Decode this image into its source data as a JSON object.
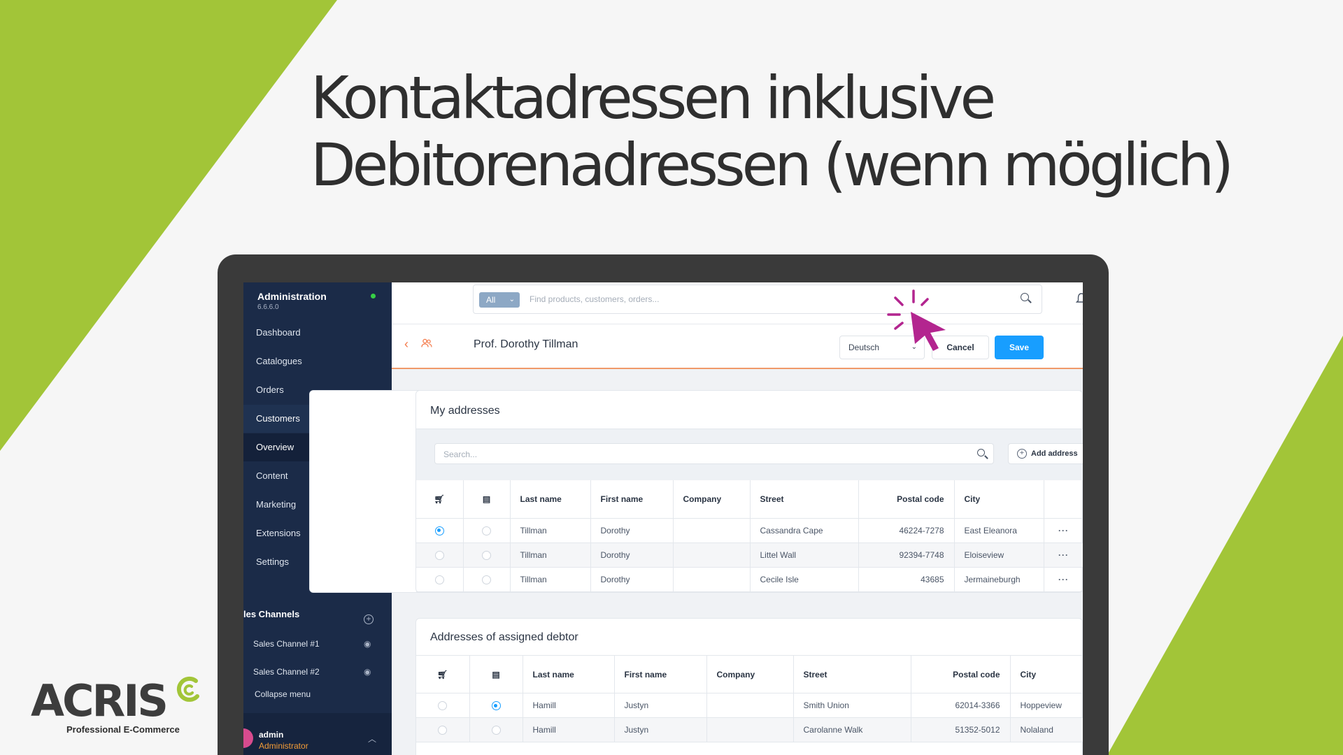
{
  "headline": {
    "line1": "Kontaktadressen inklusive",
    "line2": "Debitorenadressen (wenn möglich)"
  },
  "colors": {
    "accent_green": "#a2c538",
    "sidebar_bg": "#1b2b48",
    "primary_blue": "#189eff",
    "cursor_magenta": "#b3258f",
    "brand_orange": "#f47a4a"
  },
  "sidebar": {
    "title": "Administration",
    "version": "6.6.6.0",
    "items": [
      {
        "label": "Dashboard"
      },
      {
        "label": "Catalogues"
      },
      {
        "label": "Orders"
      },
      {
        "label": "Customers"
      },
      {
        "label": "Overview"
      },
      {
        "label": "Content"
      },
      {
        "label": "Marketing"
      },
      {
        "label": "Extensions"
      },
      {
        "label": "Settings"
      }
    ],
    "sales_channels_label": "les Channels",
    "channels": [
      {
        "label": "Sales Channel #1"
      },
      {
        "label": "Sales Channel #2"
      }
    ],
    "collapse_label": "Collapse menu",
    "user": {
      "name": "admin",
      "role": "Administrator"
    }
  },
  "topbar": {
    "scope": "All",
    "search_placeholder": "Find products, customers, orders..."
  },
  "smartbar": {
    "heading": "Prof. Dorothy Tillman",
    "language": "Deutsch",
    "cancel_label": "Cancel",
    "save_label": "Save"
  },
  "my_addresses": {
    "title": "My addresses",
    "search_placeholder": "Search...",
    "add_label": "Add address",
    "columns": [
      "Last name",
      "First name",
      "Company",
      "Street",
      "Postal code",
      "City"
    ],
    "rows": [
      {
        "default_shipping": true,
        "default_billing": false,
        "last_name": "Tillman",
        "first_name": "Dorothy",
        "company": "",
        "street": "Cassandra Cape",
        "postal": "46224-7278",
        "city": "East Eleanora"
      },
      {
        "default_shipping": false,
        "default_billing": false,
        "last_name": "Tillman",
        "first_name": "Dorothy",
        "company": "",
        "street": "Littel Wall",
        "postal": "92394-7748",
        "city": "Eloiseview"
      },
      {
        "default_shipping": false,
        "default_billing": false,
        "last_name": "Tillman",
        "first_name": "Dorothy",
        "company": "",
        "street": "Cecile Isle",
        "postal": "43685",
        "city": "Jermaineburgh"
      }
    ],
    "row_menu": "···"
  },
  "debtor_addresses": {
    "title": "Addresses of assigned debtor",
    "columns": [
      "Last name",
      "First name",
      "Company",
      "Street",
      "Postal code",
      "City"
    ],
    "rows": [
      {
        "default_shipping": false,
        "default_billing": true,
        "last_name": "Hamill",
        "first_name": "Justyn",
        "company": "",
        "street": "Smith Union",
        "postal": "62014-3366",
        "city": "Hoppeview"
      },
      {
        "default_shipping": false,
        "default_billing": false,
        "last_name": "Hamill",
        "first_name": "Justyn",
        "company": "",
        "street": "Carolanne Walk",
        "postal": "51352-5012",
        "city": "Nolaland"
      }
    ]
  },
  "logo": {
    "name": "ACRIS",
    "tagline": "Professional E-Commerce"
  }
}
